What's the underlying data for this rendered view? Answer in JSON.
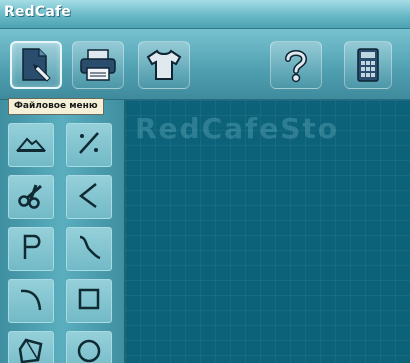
{
  "window": {
    "title": "RedCafe"
  },
  "toolbar": {
    "buttons": [
      {
        "icon": "file-menu-icon",
        "active": true
      },
      {
        "icon": "printer-icon",
        "active": false
      },
      {
        "icon": "shirt-icon",
        "active": false
      },
      {
        "icon": "help-icon",
        "active": false
      },
      {
        "icon": "calculator-icon",
        "active": false
      }
    ],
    "tooltip": "Файловое меню"
  },
  "tools": [
    {
      "icon": "mountain-shape-icon",
      "glyph": "⌂"
    },
    {
      "icon": "diagonal-line-icon",
      "glyph": "⁄"
    },
    {
      "icon": "scissors-icon",
      "glyph": "✂"
    },
    {
      "icon": "angle-icon",
      "glyph": "<"
    },
    {
      "icon": "letter-p-icon",
      "glyph": "P"
    },
    {
      "icon": "s-curve-icon",
      "glyph": "∫"
    },
    {
      "icon": "arc-curve-icon",
      "glyph": "⌒"
    },
    {
      "icon": "rectangle-icon",
      "glyph": "□"
    },
    {
      "icon": "polygon-icon",
      "glyph": "⬠"
    },
    {
      "icon": "circle-icon",
      "glyph": "○"
    }
  ],
  "canvas": {
    "watermark": "RedCafeSto"
  },
  "colors": {
    "accent": "#0b6279",
    "toolbar": "#5aaebe",
    "tooltip_bg": "#f5f1d9"
  }
}
